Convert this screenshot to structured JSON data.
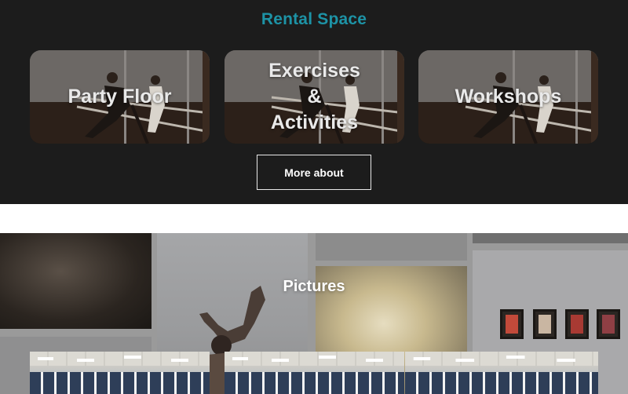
{
  "rental": {
    "title": "Rental Space",
    "title_color": "#1d93a6",
    "background": "#1c1c1c",
    "cards": [
      {
        "lines": [
          "Party Floor"
        ]
      },
      {
        "lines": [
          "Exercises",
          "&",
          "Activities"
        ]
      },
      {
        "lines": [
          "Workshops"
        ]
      }
    ],
    "more_button_label": "More about"
  },
  "pictures": {
    "title": "Pictures"
  }
}
